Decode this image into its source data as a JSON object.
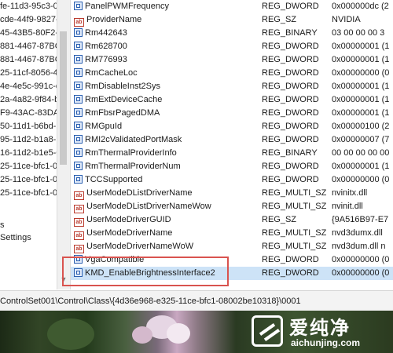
{
  "tree": {
    "items": [
      "fe-11d3-95c3-0",
      "cde-44f9-9827-7",
      "45-43B5-80F2-",
      "881-4467-87BC-",
      "881-4467-87BC-",
      "25-11cf-8056-4",
      "4e-4e5c-991c-d",
      "2a-4a82-9f84-b",
      "F9-43AC-83DA-",
      "50-11d1-b6bd-",
      "95-11d2-b1a8-",
      "16-11d2-b1e5-0",
      "25-11ce-bfc1-0",
      "25-11ce-bfc1-0",
      "25-11ce-bfc1-0",
      "",
      "s",
      "Settings"
    ]
  },
  "values": {
    "rows": [
      {
        "icon": "binary",
        "name": "PanelPWMFrequency",
        "type": "REG_DWORD",
        "data": "0x000000dc (2"
      },
      {
        "icon": "string",
        "name": "ProviderName",
        "type": "REG_SZ",
        "data": "NVIDIA"
      },
      {
        "icon": "binary",
        "name": "Rm442643",
        "type": "REG_BINARY",
        "data": "03 00 00 00 3"
      },
      {
        "icon": "binary",
        "name": "Rm628700",
        "type": "REG_DWORD",
        "data": "0x00000001 (1"
      },
      {
        "icon": "binary",
        "name": "RM776993",
        "type": "REG_DWORD",
        "data": "0x00000001 (1"
      },
      {
        "icon": "binary",
        "name": "RmCacheLoc",
        "type": "REG_DWORD",
        "data": "0x00000000 (0"
      },
      {
        "icon": "binary",
        "name": "RmDisableInst2Sys",
        "type": "REG_DWORD",
        "data": "0x00000001 (1"
      },
      {
        "icon": "binary",
        "name": "RmExtDeviceCache",
        "type": "REG_DWORD",
        "data": "0x00000001 (1"
      },
      {
        "icon": "binary",
        "name": "RmFbsrPagedDMA",
        "type": "REG_DWORD",
        "data": "0x00000001 (1"
      },
      {
        "icon": "binary",
        "name": "RMGpuId",
        "type": "REG_DWORD",
        "data": "0x00000100 (2"
      },
      {
        "icon": "binary",
        "name": "RMI2cValidatedPortMask",
        "type": "REG_DWORD",
        "data": "0x00000007 (7"
      },
      {
        "icon": "binary",
        "name": "RmThermalProviderInfo",
        "type": "REG_BINARY",
        "data": "00 00 00 00 00"
      },
      {
        "icon": "binary",
        "name": "RmThermalProviderNum",
        "type": "REG_DWORD",
        "data": "0x00000001 (1"
      },
      {
        "icon": "binary",
        "name": "TCCSupported",
        "type": "REG_DWORD",
        "data": "0x00000000 (0"
      },
      {
        "icon": "string",
        "name": "UserModeDListDriverName",
        "type": "REG_MULTI_SZ",
        "data": "nvinitx.dll"
      },
      {
        "icon": "string",
        "name": "UserModeDListDriverNameWow",
        "type": "REG_MULTI_SZ",
        "data": "nvinit.dll"
      },
      {
        "icon": "string",
        "name": "UserModeDriverGUID",
        "type": "REG_SZ",
        "data": "{9A516B97-E7"
      },
      {
        "icon": "string",
        "name": "UserModeDriverName",
        "type": "REG_MULTI_SZ",
        "data": "nvd3dumx.dll"
      },
      {
        "icon": "string",
        "name": "UserModeDriverNameWoW",
        "type": "REG_MULTI_SZ",
        "data": "nvd3dum.dll n"
      },
      {
        "icon": "binary",
        "name": "VgaCompatible",
        "type": "REG_DWORD",
        "data": "0x00000000 (0"
      },
      {
        "icon": "binary",
        "name": "KMD_EnableBrightnessInterface2",
        "type": "REG_DWORD",
        "data": "0x00000000 (0"
      }
    ]
  },
  "statusbar": {
    "path": "ControlSet001\\Control\\Class\\{4d36e968-e325-11ce-bfc1-08002be10318}\\0001"
  },
  "watermark": {
    "name_cn": "爱纯净",
    "url": "aichunjing.com"
  }
}
